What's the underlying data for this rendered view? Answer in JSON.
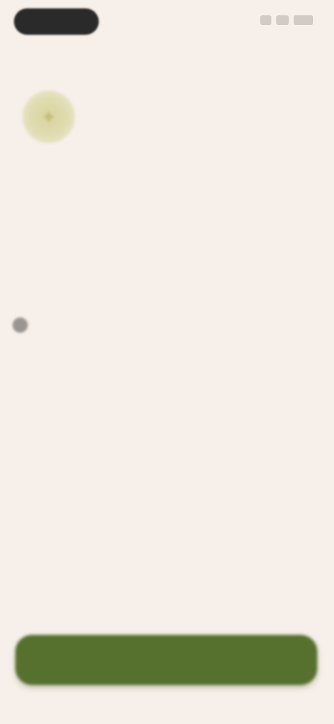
{
  "status_bar": {
    "icons": [
      "signal-icon",
      "wifi-icon",
      "battery-icon"
    ]
  },
  "app": {
    "icon": "app-logo-icon",
    "accent_color": "#56702e",
    "background_color": "#f7efe9"
  },
  "main": {
    "title": "",
    "info_lines": [
      "",
      "",
      "",
      ""
    ]
  },
  "footer": {
    "primary_button_label": ""
  }
}
